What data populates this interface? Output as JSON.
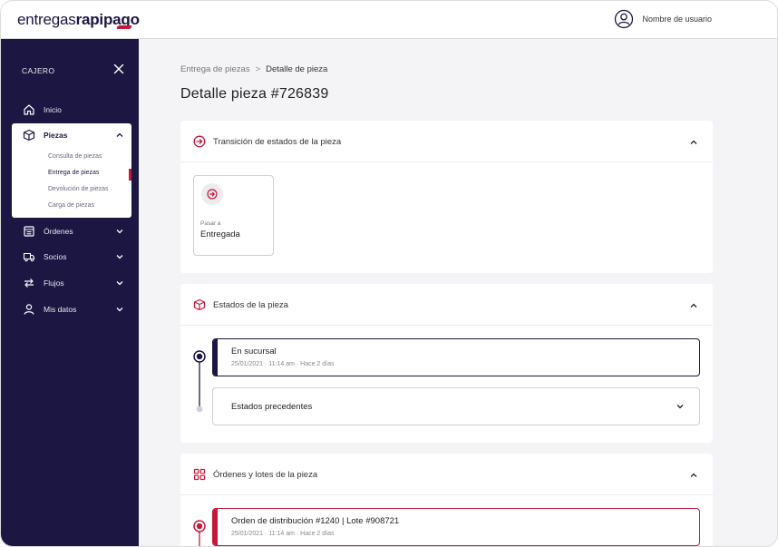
{
  "header": {
    "logo_light": "entregas",
    "logo_bold": "rapipago",
    "user_name": "Nombre de usuario"
  },
  "sidebar": {
    "title": "CAJERO",
    "items": [
      {
        "label": "Inicio",
        "icon": "home-icon"
      },
      {
        "label": "Piezas",
        "icon": "box-icon",
        "expanded": true
      },
      {
        "label": "Órdenes",
        "icon": "orders-icon"
      },
      {
        "label": "Socios",
        "icon": "truck-icon"
      },
      {
        "label": "Flujos",
        "icon": "flow-arrows-icon"
      },
      {
        "label": "Mis datos",
        "icon": "user-icon"
      }
    ],
    "subitems": [
      {
        "label": "Consulta de piezas"
      },
      {
        "label": "Entrega de piezas",
        "active": true
      },
      {
        "label": "Devolución de piezas"
      },
      {
        "label": "Carga de piezas"
      }
    ]
  },
  "breadcrumb": {
    "parent": "Entrega de piezas",
    "separator": ">",
    "current": "Detalle de pieza"
  },
  "page_title": "Detalle pieza #726839",
  "transition_card": {
    "title": "Transición de estados de la pieza",
    "tile_label": "Pasar a",
    "tile_value": "Entregada"
  },
  "states_card": {
    "title": "Estados de la pieza",
    "current_state": {
      "title": "En sucursal",
      "subtitle": "25/01/2021 · 11:14 am · Hace 2 días"
    },
    "previous_label": "Estados precedentes"
  },
  "orders_card": {
    "title": "Órdenes y lotes de la pieza",
    "order": {
      "title": "Orden de distribución #1240 | Lote #908721",
      "subtitle": "25/01/2021 · 11:14 am · Hace 2 días"
    }
  },
  "colors": {
    "navy": "#1c1642",
    "accent": "#c4173a",
    "background": "#f4f4f6"
  }
}
